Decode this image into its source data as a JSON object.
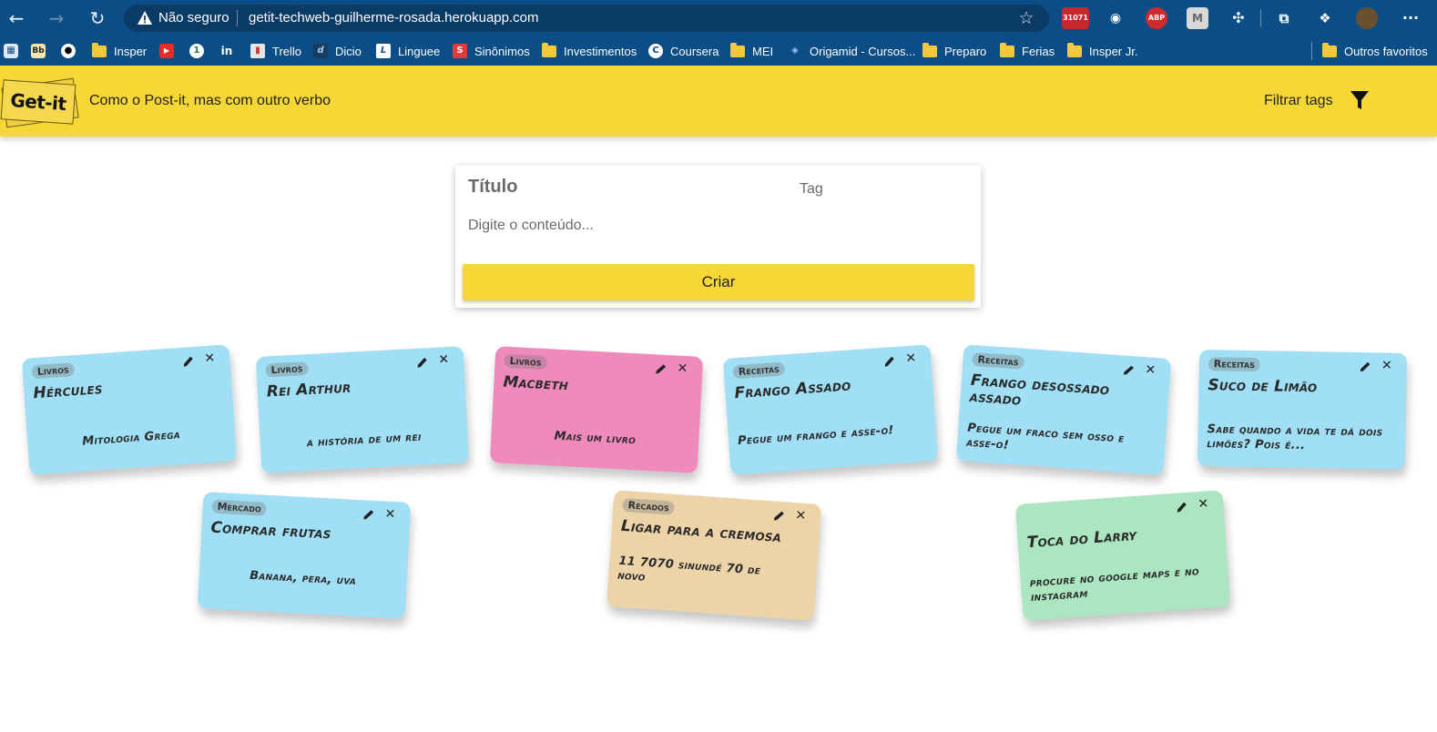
{
  "browser": {
    "not_secure": "Não seguro",
    "url": "getit-techweb-guilherme-rosada.herokuapp.com",
    "ext_badge": "31071",
    "ext_abp": "ABP",
    "ext_m": "M",
    "more": "···"
  },
  "bookmarks": [
    {
      "label": "",
      "icon": "Bb"
    },
    {
      "label": "",
      "icon": "github"
    },
    {
      "label": "Insper",
      "icon": "folder"
    },
    {
      "label": "",
      "icon": "youtube"
    },
    {
      "label": "",
      "icon": "1"
    },
    {
      "label": "",
      "icon": "in"
    },
    {
      "label": "Trello",
      "icon": "trello"
    },
    {
      "label": "Dicio",
      "icon": "dicio"
    },
    {
      "label": "Linguee",
      "icon": "linguee"
    },
    {
      "label": "Sinônimos",
      "icon": "S"
    },
    {
      "label": "Investimentos",
      "icon": "folder"
    },
    {
      "label": "Coursera",
      "icon": "C"
    },
    {
      "label": "MEI",
      "icon": "folder"
    },
    {
      "label": "Origamid - Cursos...",
      "icon": "origamid"
    },
    {
      "label": "Preparo",
      "icon": "folder"
    },
    {
      "label": "Ferias",
      "icon": "folder"
    },
    {
      "label": "Insper Jr.",
      "icon": "folder"
    },
    {
      "label": "Outros favoritos",
      "icon": "folder"
    }
  ],
  "header": {
    "logo_text": "Get-it",
    "tagline": "Como o Post-it, mas com outro verbo",
    "filter_label": "Filtrar tags"
  },
  "form": {
    "title_placeholder": "Título",
    "tag_placeholder": "Tag",
    "content_placeholder": "Digite o conteúdo...",
    "submit_label": "Criar"
  },
  "notes": [
    {
      "tag": "Livros",
      "title": "Hércules",
      "content": "Mitologia Grega",
      "color": "#a0dff5"
    },
    {
      "tag": "Livros",
      "title": "Rei Arthur",
      "content": "a história de um rei",
      "color": "#a0dff5"
    },
    {
      "tag": "Livros",
      "title": "Macbeth",
      "content": "Mais um livro",
      "color": "#ef8abd"
    },
    {
      "tag": "Receitas",
      "title": "Frango Assado",
      "content": "Pegue um frango e asse-o!",
      "color": "#a0dff5"
    },
    {
      "tag": "Receitas",
      "title": "Frango desossado assado",
      "content": "Pegue um fraco sem osso e asse-o!",
      "color": "#a0dff5"
    },
    {
      "tag": "Receitas",
      "title": "Suco de Limão",
      "content": "Sabe quando a vida te dá dois limões? Pois é...",
      "color": "#a0dff5"
    },
    {
      "tag": "Mercado",
      "title": "Comprar frutas",
      "content": "Banana, pera, uva",
      "color": "#a0dff5"
    },
    {
      "tag": "Recados",
      "title": "Ligar para a cremosa",
      "content": "11 7070 sinundé 70 de novo",
      "color": "#ecd4a8"
    },
    {
      "tag": "",
      "title": "Toca do Larry",
      "content": "procure no google maps e no instagram",
      "color": "#abe6c0"
    }
  ],
  "colors": {
    "accent_yellow": "#f7d736",
    "browser_blue": "#0b4d86"
  }
}
